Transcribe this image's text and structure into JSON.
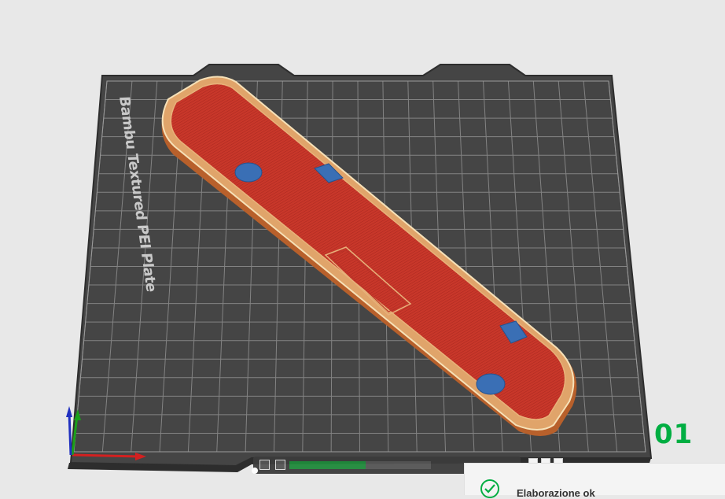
{
  "bed": {
    "plate_name": "Bambu Textured PEI Plate",
    "plate_number": "01",
    "grid_color": "#8a8a8a",
    "surface_color": "#454545"
  },
  "model": {
    "top_color": "#c8372a",
    "wall_color": "#c0652e",
    "support_color": "#3a6fb5"
  },
  "axes": {
    "x_color": "#d32020",
    "y_color": "#1aa01a",
    "z_color": "#2030c0"
  },
  "layer_bar": {
    "progress_fraction": 0.54,
    "readout": ""
  },
  "notification": {
    "status": "Elaborazione ok",
    "accent": "#00ae42"
  }
}
